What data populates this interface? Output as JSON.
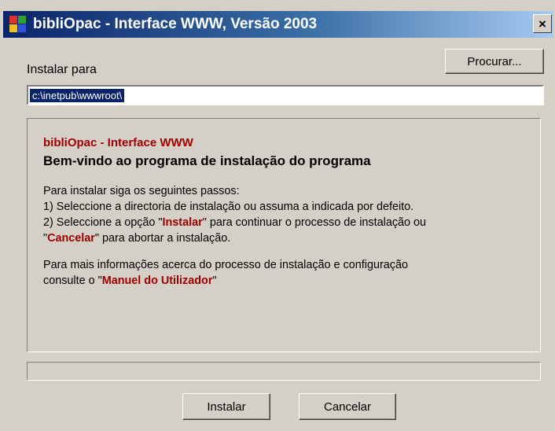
{
  "window": {
    "title": "bibliOpac - Interface WWW, Versão 2003",
    "close_glyph": "×"
  },
  "install": {
    "label": "Instalar para",
    "browse_label": "Procurar...",
    "path_value": "c:\\inetpub\\wwwroot\\"
  },
  "panel": {
    "app_name": "bibliOpac - Interface WWW",
    "welcome": "Bem-vindo ao programa de instalação do programa",
    "intro": "Para instalar siga os seguintes passos:",
    "step1": "1) Seleccione a directoria de instalação ou assuma a indicada por defeito.",
    "step2_pre": "2) Seleccione a opção \"",
    "step2_kw1": "Instalar",
    "step2_post": "\" para continuar o processo de instalação ou",
    "step2b_pre": "\"",
    "step2b_kw": "Cancelar",
    "step2b_post": "\" para abortar a instalação.",
    "info_line1": "Para mais informações acerca do processo de instalação e configuração",
    "info_pre": "consulte o \"",
    "info_kw": "Manuel do Utilizador",
    "info_post": "\""
  },
  "progress": {
    "fraction": 0
  },
  "buttons": {
    "install_label": "Instalar",
    "cancel_label": "Cancelar"
  },
  "colors": {
    "keyword": "#a00000",
    "titlebar": "#0a246a",
    "face": "#d4d0c8"
  },
  "icons": {
    "app": "app-icon",
    "close": "close-icon"
  }
}
